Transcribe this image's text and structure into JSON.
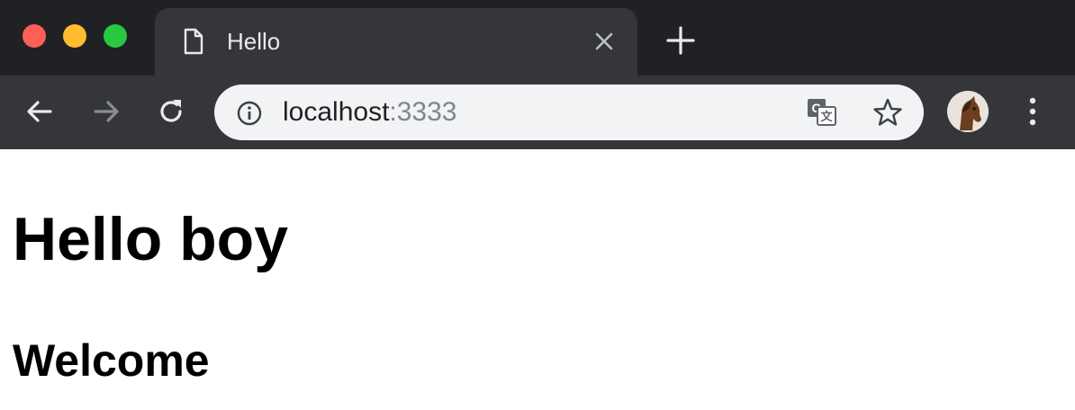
{
  "window": {
    "traffic_lights": [
      "close",
      "minimize",
      "maximize"
    ]
  },
  "tab": {
    "title": "Hello",
    "icon": "document-icon",
    "close_icon": "close-icon"
  },
  "new_tab": {
    "icon": "plus-icon"
  },
  "toolbar": {
    "back_icon": "arrow-left-icon",
    "forward_icon": "arrow-right-icon",
    "reload_icon": "reload-icon",
    "menu_icon": "vertical-dots-icon"
  },
  "omnibox": {
    "host": "localhost",
    "port": ":3333",
    "info_icon": "info-icon",
    "translate_icon": "translate-icon",
    "star_icon": "star-icon"
  },
  "profile": {
    "avatar": "horse-avatar"
  },
  "page": {
    "heading": "Hello boy",
    "subheading": "Welcome"
  },
  "colors": {
    "titlebar_bg": "#202124",
    "toolbar_bg": "#35363a",
    "omnibox_bg": "#f1f3f4",
    "close_light": "#ff5f57",
    "minimize_light": "#febc2e",
    "maximize_light": "#28c840"
  }
}
